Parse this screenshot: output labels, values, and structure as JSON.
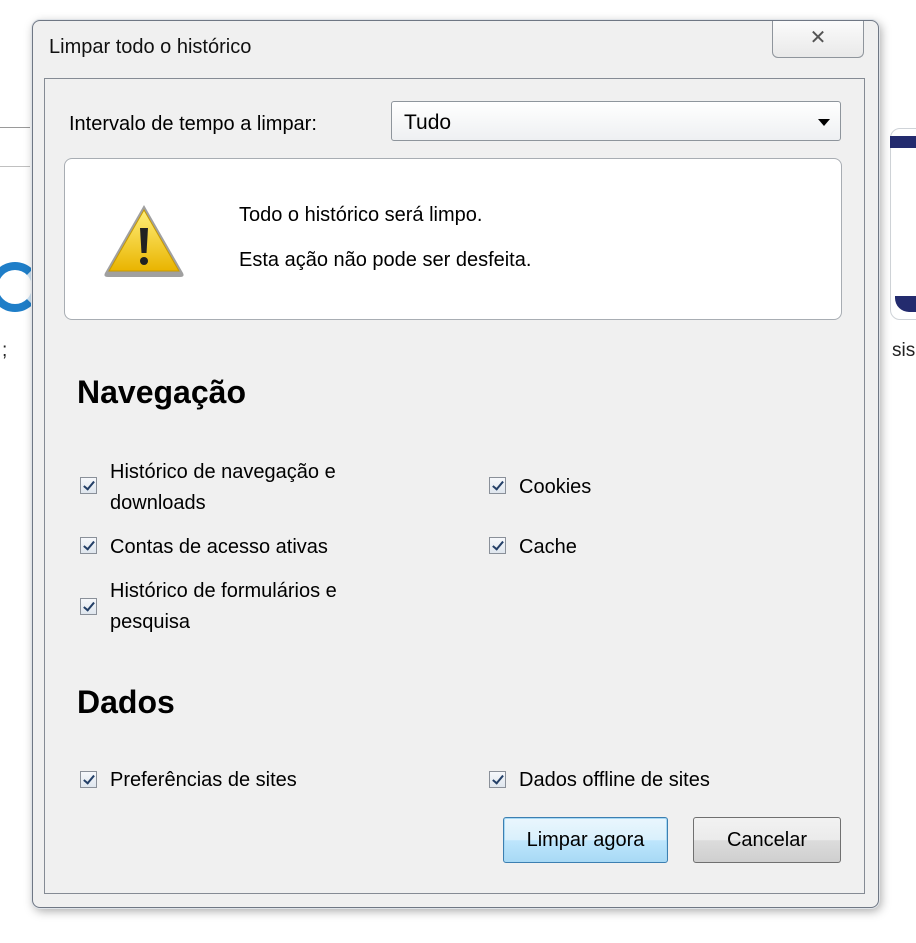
{
  "background": {
    "right_text": "sis",
    "left_text": ";"
  },
  "dialog": {
    "title": "Limpar todo o histórico",
    "close_glyph": "✕",
    "range_label": "Intervalo de tempo a limpar:",
    "range_value": "Tudo",
    "warning": {
      "icon": "warning-icon",
      "line1": "Todo o histórico será limpo.",
      "line2": "Esta ação não pode ser desfeita."
    },
    "sections": {
      "navegacao": {
        "title": "Navegação",
        "options": [
          {
            "label_line1": "Histórico de navegação e",
            "label_line2": "downloads",
            "checked": true
          },
          {
            "label": "Cookies",
            "checked": true
          },
          {
            "label": "Contas de acesso ativas",
            "checked": true
          },
          {
            "label": "Cache",
            "checked": true
          },
          {
            "label_line1": "Histórico de formulários e",
            "label_line2": "pesquisa",
            "checked": true
          }
        ]
      },
      "dados": {
        "title": "Dados",
        "options": [
          {
            "label": "Preferências de sites",
            "checked": true
          },
          {
            "label": "Dados offline de sites",
            "checked": true
          }
        ]
      }
    },
    "buttons": {
      "clear": "Limpar agora",
      "cancel": "Cancelar"
    }
  }
}
